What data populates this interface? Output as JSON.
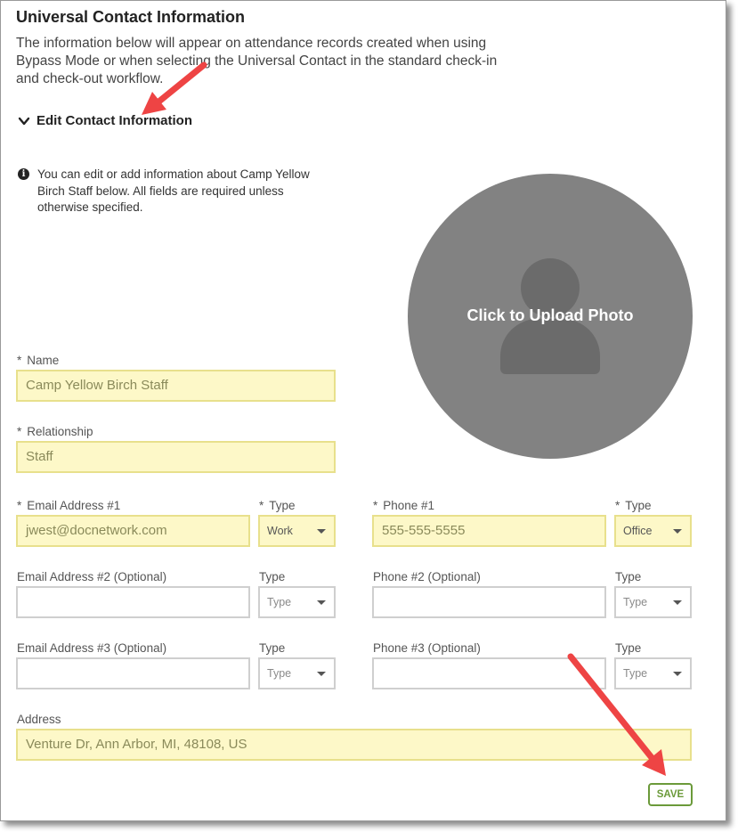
{
  "section": {
    "title": "Universal Contact Information",
    "description": "The information below will appear on attendance records created when using Bypass Mode or when selecting the Universal Contact in the standard check-in and check-out workflow."
  },
  "edit_toggle": {
    "label": "Edit Contact Information",
    "icon": "chevron-down-icon"
  },
  "info": {
    "icon": "info-icon",
    "text": "You can edit or add information about Camp Yellow Birch Staff below. All fields are required unless otherwise specified."
  },
  "photo": {
    "label": "Click to Upload Photo",
    "icon": "user-silhouette-icon"
  },
  "form": {
    "required_marker": "*",
    "name": {
      "label": "Name",
      "value": "Camp Yellow Birch Staff"
    },
    "relationship": {
      "label": "Relationship",
      "value": "Staff"
    },
    "email1": {
      "label": "Email Address #1",
      "value": "jwest@docnetwork.com"
    },
    "email1_type": {
      "label": "Type",
      "value": "Work"
    },
    "phone1": {
      "label": "Phone #1",
      "value": "555-555-5555"
    },
    "phone1_type": {
      "label": "Type",
      "value": "Office"
    },
    "email2": {
      "label": "Email Address #2 (Optional)",
      "value": ""
    },
    "email2_type": {
      "label": "Type",
      "value": "Type"
    },
    "phone2": {
      "label": "Phone #2 (Optional)",
      "value": ""
    },
    "phone2_type": {
      "label": "Type",
      "value": "Type"
    },
    "email3": {
      "label": "Email Address #3 (Optional)",
      "value": ""
    },
    "email3_type": {
      "label": "Type",
      "value": "Type"
    },
    "phone3": {
      "label": "Phone #3 (Optional)",
      "value": ""
    },
    "phone3_type": {
      "label": "Type",
      "value": "Type"
    },
    "address": {
      "label": "Address",
      "value": "Venture Dr, Ann Arbor, MI, 48108, US"
    }
  },
  "save_button": {
    "label": "SAVE"
  },
  "colors": {
    "highlight_fill": "#fdf8c8",
    "photo_circle": "#828282",
    "save_green": "#6b9a3a",
    "annotation_arrow": "#ee4444"
  }
}
